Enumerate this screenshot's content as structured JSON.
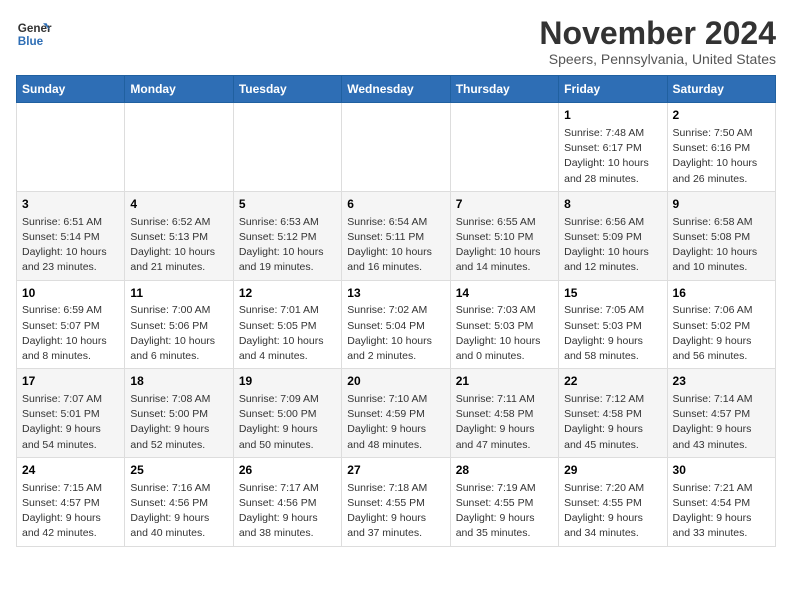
{
  "logo": {
    "line1": "General",
    "line2": "Blue"
  },
  "title": "November 2024",
  "location": "Speers, Pennsylvania, United States",
  "days_of_week": [
    "Sunday",
    "Monday",
    "Tuesday",
    "Wednesday",
    "Thursday",
    "Friday",
    "Saturday"
  ],
  "weeks": [
    [
      {
        "day": "",
        "detail": ""
      },
      {
        "day": "",
        "detail": ""
      },
      {
        "day": "",
        "detail": ""
      },
      {
        "day": "",
        "detail": ""
      },
      {
        "day": "",
        "detail": ""
      },
      {
        "day": "1",
        "detail": "Sunrise: 7:48 AM\nSunset: 6:17 PM\nDaylight: 10 hours\nand 28 minutes."
      },
      {
        "day": "2",
        "detail": "Sunrise: 7:50 AM\nSunset: 6:16 PM\nDaylight: 10 hours\nand 26 minutes."
      }
    ],
    [
      {
        "day": "3",
        "detail": "Sunrise: 6:51 AM\nSunset: 5:14 PM\nDaylight: 10 hours\nand 23 minutes."
      },
      {
        "day": "4",
        "detail": "Sunrise: 6:52 AM\nSunset: 5:13 PM\nDaylight: 10 hours\nand 21 minutes."
      },
      {
        "day": "5",
        "detail": "Sunrise: 6:53 AM\nSunset: 5:12 PM\nDaylight: 10 hours\nand 19 minutes."
      },
      {
        "day": "6",
        "detail": "Sunrise: 6:54 AM\nSunset: 5:11 PM\nDaylight: 10 hours\nand 16 minutes."
      },
      {
        "day": "7",
        "detail": "Sunrise: 6:55 AM\nSunset: 5:10 PM\nDaylight: 10 hours\nand 14 minutes."
      },
      {
        "day": "8",
        "detail": "Sunrise: 6:56 AM\nSunset: 5:09 PM\nDaylight: 10 hours\nand 12 minutes."
      },
      {
        "day": "9",
        "detail": "Sunrise: 6:58 AM\nSunset: 5:08 PM\nDaylight: 10 hours\nand 10 minutes."
      }
    ],
    [
      {
        "day": "10",
        "detail": "Sunrise: 6:59 AM\nSunset: 5:07 PM\nDaylight: 10 hours\nand 8 minutes."
      },
      {
        "day": "11",
        "detail": "Sunrise: 7:00 AM\nSunset: 5:06 PM\nDaylight: 10 hours\nand 6 minutes."
      },
      {
        "day": "12",
        "detail": "Sunrise: 7:01 AM\nSunset: 5:05 PM\nDaylight: 10 hours\nand 4 minutes."
      },
      {
        "day": "13",
        "detail": "Sunrise: 7:02 AM\nSunset: 5:04 PM\nDaylight: 10 hours\nand 2 minutes."
      },
      {
        "day": "14",
        "detail": "Sunrise: 7:03 AM\nSunset: 5:03 PM\nDaylight: 10 hours\nand 0 minutes."
      },
      {
        "day": "15",
        "detail": "Sunrise: 7:05 AM\nSunset: 5:03 PM\nDaylight: 9 hours\nand 58 minutes."
      },
      {
        "day": "16",
        "detail": "Sunrise: 7:06 AM\nSunset: 5:02 PM\nDaylight: 9 hours\nand 56 minutes."
      }
    ],
    [
      {
        "day": "17",
        "detail": "Sunrise: 7:07 AM\nSunset: 5:01 PM\nDaylight: 9 hours\nand 54 minutes."
      },
      {
        "day": "18",
        "detail": "Sunrise: 7:08 AM\nSunset: 5:00 PM\nDaylight: 9 hours\nand 52 minutes."
      },
      {
        "day": "19",
        "detail": "Sunrise: 7:09 AM\nSunset: 5:00 PM\nDaylight: 9 hours\nand 50 minutes."
      },
      {
        "day": "20",
        "detail": "Sunrise: 7:10 AM\nSunset: 4:59 PM\nDaylight: 9 hours\nand 48 minutes."
      },
      {
        "day": "21",
        "detail": "Sunrise: 7:11 AM\nSunset: 4:58 PM\nDaylight: 9 hours\nand 47 minutes."
      },
      {
        "day": "22",
        "detail": "Sunrise: 7:12 AM\nSunset: 4:58 PM\nDaylight: 9 hours\nand 45 minutes."
      },
      {
        "day": "23",
        "detail": "Sunrise: 7:14 AM\nSunset: 4:57 PM\nDaylight: 9 hours\nand 43 minutes."
      }
    ],
    [
      {
        "day": "24",
        "detail": "Sunrise: 7:15 AM\nSunset: 4:57 PM\nDaylight: 9 hours\nand 42 minutes."
      },
      {
        "day": "25",
        "detail": "Sunrise: 7:16 AM\nSunset: 4:56 PM\nDaylight: 9 hours\nand 40 minutes."
      },
      {
        "day": "26",
        "detail": "Sunrise: 7:17 AM\nSunset: 4:56 PM\nDaylight: 9 hours\nand 38 minutes."
      },
      {
        "day": "27",
        "detail": "Sunrise: 7:18 AM\nSunset: 4:55 PM\nDaylight: 9 hours\nand 37 minutes."
      },
      {
        "day": "28",
        "detail": "Sunrise: 7:19 AM\nSunset: 4:55 PM\nDaylight: 9 hours\nand 35 minutes."
      },
      {
        "day": "29",
        "detail": "Sunrise: 7:20 AM\nSunset: 4:55 PM\nDaylight: 9 hours\nand 34 minutes."
      },
      {
        "day": "30",
        "detail": "Sunrise: 7:21 AM\nSunset: 4:54 PM\nDaylight: 9 hours\nand 33 minutes."
      }
    ]
  ]
}
